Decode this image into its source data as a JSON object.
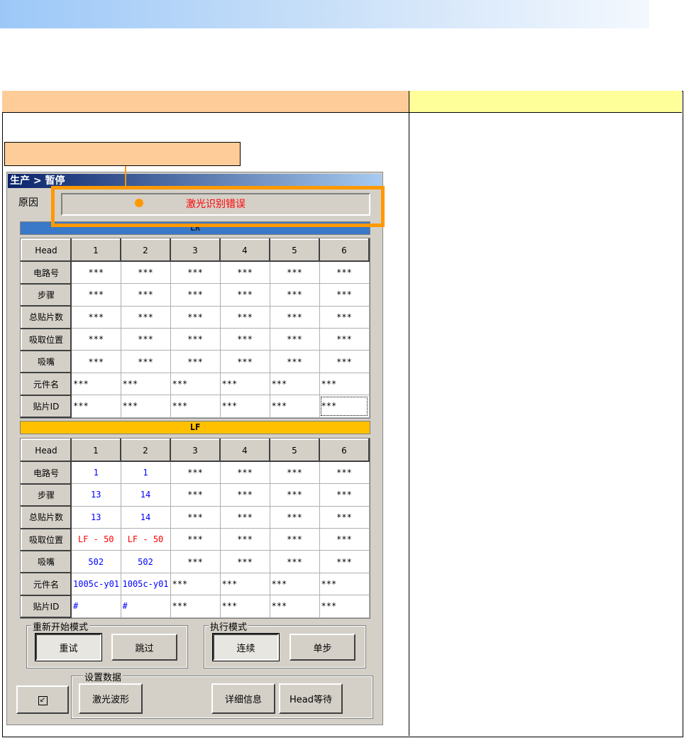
{
  "dialog": {
    "title": "生产 > 暂停",
    "reason_label": "原因",
    "reason_value": "激光识别错误"
  },
  "lr": {
    "label": "LR",
    "header": [
      "Head",
      "1",
      "2",
      "3",
      "4",
      "5",
      "6"
    ],
    "rows": [
      {
        "label": "电路号",
        "cells": [
          "***",
          "***",
          "***",
          "***",
          "***",
          "***"
        ]
      },
      {
        "label": "步骤",
        "cells": [
          "***",
          "***",
          "***",
          "***",
          "***",
          "***"
        ]
      },
      {
        "label": "总贴片数",
        "cells": [
          "***",
          "***",
          "***",
          "***",
          "***",
          "***"
        ]
      },
      {
        "label": "吸取位置",
        "cells": [
          "***",
          "***",
          "***",
          "***",
          "***",
          "***"
        ]
      },
      {
        "label": "吸嘴",
        "cells": [
          "***",
          "***",
          "***",
          "***",
          "***",
          "***"
        ]
      },
      {
        "label": "元件名",
        "cells": [
          "***",
          "***",
          "***",
          "***",
          "***",
          "***"
        ]
      },
      {
        "label": "贴片ID",
        "cells": [
          "***",
          "***",
          "***",
          "***",
          "***",
          "***"
        ]
      }
    ]
  },
  "lf": {
    "label": "LF",
    "header": [
      "Head",
      "1",
      "2",
      "3",
      "4",
      "5",
      "6"
    ],
    "rows": [
      {
        "label": "电路号",
        "cells": [
          "1",
          "1",
          "***",
          "***",
          "***",
          "***"
        ]
      },
      {
        "label": "步骤",
        "cells": [
          "13",
          "14",
          "***",
          "***",
          "***",
          "***"
        ]
      },
      {
        "label": "总贴片数",
        "cells": [
          "13",
          "14",
          "***",
          "***",
          "***",
          "***"
        ]
      },
      {
        "label": "吸取位置",
        "cells": [
          "LF - 50",
          "LF - 50",
          "***",
          "***",
          "***",
          "***"
        ]
      },
      {
        "label": "吸嘴",
        "cells": [
          "502",
          "502",
          "***",
          "***",
          "***",
          "***"
        ]
      },
      {
        "label": "元件名",
        "cells": [
          "1005c-y01",
          "1005c-y01",
          "***",
          "***",
          "***",
          "***"
        ]
      },
      {
        "label": "贴片ID",
        "cells": [
          "#",
          "#",
          "***",
          "***",
          "***",
          "***"
        ]
      }
    ]
  },
  "colors": {
    "value_blue": "#0000ff",
    "value_red": "#ff0000",
    "highlight": "#ff9900"
  },
  "restart_mode": {
    "label": "重新开始模式",
    "retry": "重试",
    "skip": "跳过"
  },
  "exec_mode": {
    "label": "执行模式",
    "continuous": "连续",
    "step": "单步"
  },
  "settings": {
    "label": "设置数据",
    "laser_wave": "激光波形",
    "details": "详细信息",
    "head_wait": "Head等待"
  },
  "icons": {
    "minimize": "minimize-window-icon"
  }
}
